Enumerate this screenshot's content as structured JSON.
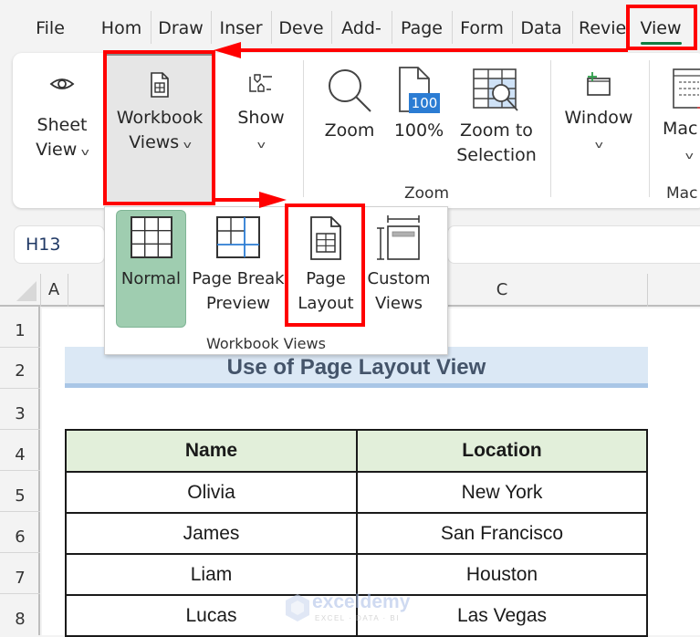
{
  "ribbon_tabs": [
    {
      "label": "File"
    },
    {
      "label": "Hom"
    },
    {
      "label": "Draw"
    },
    {
      "label": "Inser"
    },
    {
      "label": "Deve"
    },
    {
      "label": "Add-"
    },
    {
      "label": "Page"
    },
    {
      "label": "Form"
    },
    {
      "label": "Data"
    },
    {
      "label": "Revie"
    },
    {
      "label": "View",
      "active": true
    }
  ],
  "ribbon": {
    "sheet_view": {
      "line1": "Sheet",
      "line2": "View",
      "icon": "eye-icon"
    },
    "workbook_views": {
      "line1": "Workbook",
      "line2": "Views",
      "icon": "workbook-page-icon"
    },
    "show": {
      "line1": "Show",
      "icon": "show-shapes-icon"
    },
    "zoom": {
      "label": "Zoom",
      "icon": "magnifier-icon"
    },
    "zoom100": {
      "label": "100%",
      "badge": "100",
      "icon": "page-100-icon"
    },
    "zoom_selection": {
      "line1": "Zoom to",
      "line2": "Selection",
      "icon": "zoom-selection-icon"
    },
    "zoom_group_label": "Zoom",
    "window": {
      "line1": "Window",
      "icon": "new-window-icon"
    },
    "macros": {
      "line1": "Mac",
      "group_label": "Mac",
      "icon": "macros-icon"
    }
  },
  "formula_bar": {
    "name_box": "H13"
  },
  "workbook_views_dropdown": {
    "group_label": "Workbook Views",
    "items": [
      {
        "line1": "Normal",
        "line2": "",
        "icon": "normal-grid-icon",
        "selected": true
      },
      {
        "line1": "Page Break",
        "line2": "Preview",
        "icon": "page-break-icon"
      },
      {
        "line1": "Page",
        "line2": "Layout",
        "icon": "page-layout-icon",
        "highlighted": true
      },
      {
        "line1": "Custom",
        "line2": "Views",
        "icon": "custom-views-icon"
      }
    ]
  },
  "grid": {
    "columns": [
      "A",
      "C"
    ],
    "rows": [
      "1",
      "2",
      "3",
      "4",
      "5",
      "6",
      "7",
      "8"
    ]
  },
  "sheet": {
    "title": "Use of Page Layout View",
    "table": {
      "headers": [
        "Name",
        "Location"
      ],
      "rows": [
        [
          "Olivia",
          "New York"
        ],
        [
          "James",
          "San Francisco"
        ],
        [
          "Liam",
          "Houston"
        ],
        [
          "Lucas",
          "Las Vegas"
        ]
      ]
    }
  },
  "watermark": {
    "brand": "exceldemy",
    "tagline": "EXCEL · DATA · BI"
  },
  "colors": {
    "annotation_red": "#ff0000",
    "active_tab_underline": "#107c41",
    "normal_selected_bg": "#9fcdb0",
    "title_bg": "#dbe8f5",
    "header_bg": "#e2efda",
    "title_text": "#44546a"
  }
}
